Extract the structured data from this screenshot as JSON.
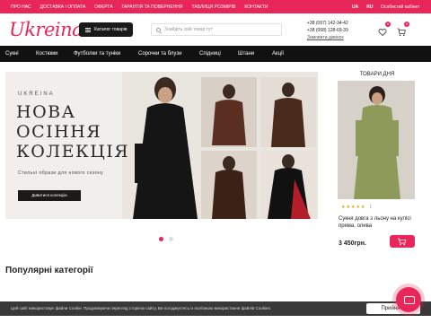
{
  "topbar": {
    "links": [
      "ПРО НАС",
      "ДОСТАВКА І ОПЛАТА",
      "ОФЕРТА",
      "ГАРАНТІЯ ТА ПОВЕРНЕННЯ",
      "ТАБЛИЦЯ РОЗМІРІВ",
      "КОНТАКТИ"
    ],
    "lang_ua": "UA",
    "lang_ru": "RU",
    "account": "Особистий кабінет"
  },
  "header": {
    "logo": "Ukreina",
    "catalog_label": "Каталог товарів",
    "search_placeholder": "Знайдіть свій товар тут",
    "phone1": "+38 (097) 142-34-42",
    "phone2": "+38 (068) 128-69-39",
    "callback": "Замовити дзвінок",
    "wishlist_count": "0",
    "cart_count": "0"
  },
  "nav": {
    "items": [
      "Сукні",
      "Костюми",
      "Футболки та туніки",
      "Сорочки та блузи",
      "Спідниці",
      "Штани",
      "Акції"
    ]
  },
  "banner": {
    "brand": "UKREINA",
    "line1": "НОВА",
    "line2": "ОСІННЯ",
    "line3": "КОЛЕКЦІЯ",
    "subtitle": "Стильні образи для нового сезону",
    "cta": "Дивитися колекцію"
  },
  "product_of_day": {
    "title": "ТОВАРИ ДНЯ",
    "rating_count": "1",
    "name": "Сукня довга з льону на кулісі пряма, олива",
    "price": "3 450грн."
  },
  "sections": {
    "popular_title": "Популярні категорії"
  },
  "cookie": {
    "text": "Цей сайт використовує файли Cookie. Продовжуючи перегляд сторінок сайту, Ви погоджуєтесь із політикою використання файлів Cookies.",
    "accept": "Прийняти"
  },
  "colors": {
    "accent": "#e8265a",
    "dark": "#111111"
  }
}
